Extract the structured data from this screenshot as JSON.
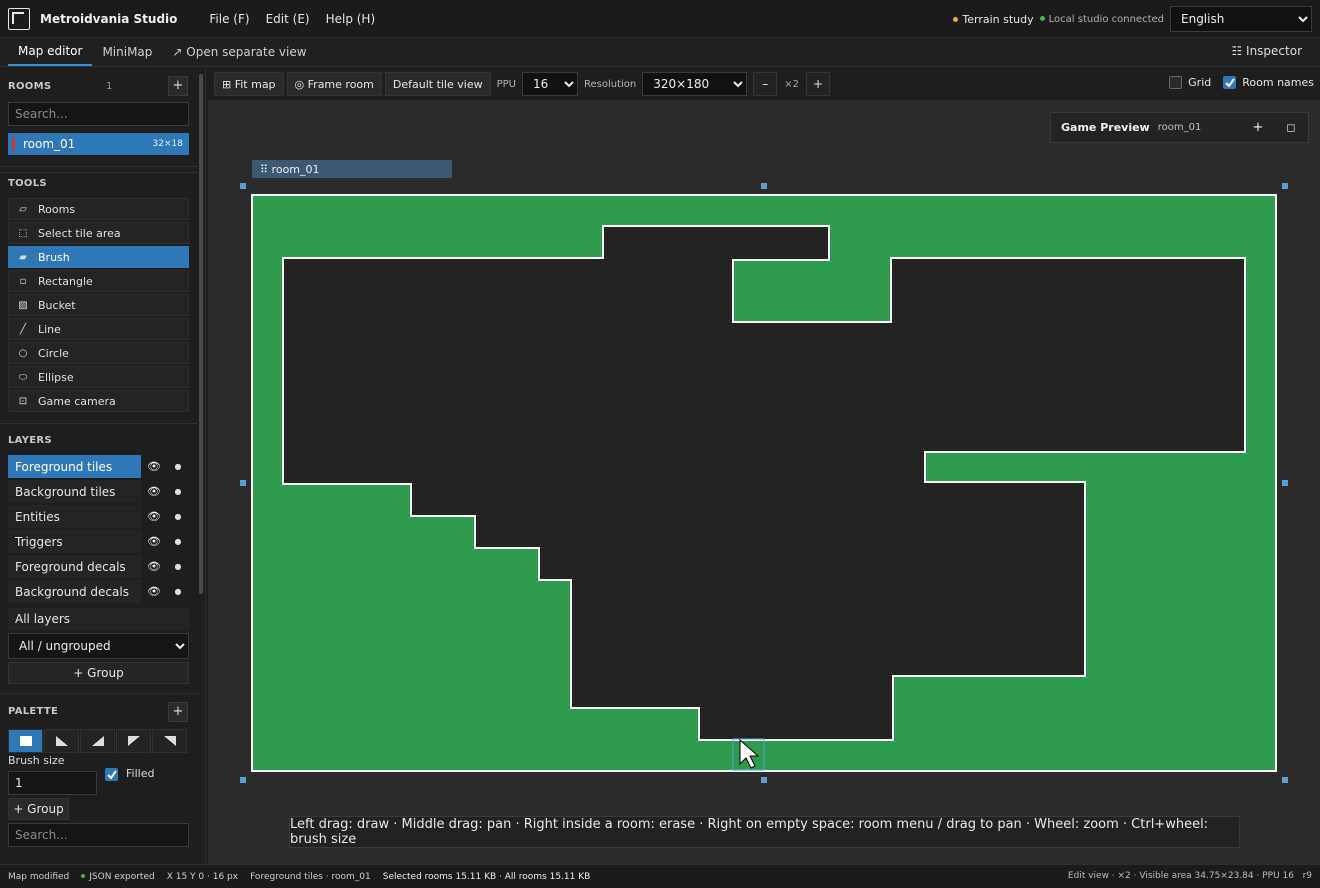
{
  "app": {
    "title": "Metroidvania Studio",
    "menu": [
      "File (F)",
      "Edit (E)",
      "Help (H)"
    ],
    "project_name": "Terrain study",
    "connection_status": "Local studio connected",
    "language": "English",
    "colors": {
      "accent": "#2f78b8",
      "terrain": "#2e9b4e",
      "empty": "#232323"
    }
  },
  "tabs": {
    "map_editor": "Map editor",
    "minimap": "MiniMap",
    "separate_view": "↗ Open separate view",
    "inspector": "☷ Inspector"
  },
  "sidebar": {
    "rooms": {
      "heading": "ROOMS",
      "count": "1",
      "add": "+",
      "search_placeholder": "Search...",
      "items": [
        {
          "name": "room_01",
          "size": "32×18"
        }
      ]
    },
    "tools": {
      "heading": "TOOLS",
      "items": [
        {
          "label": "Rooms",
          "icon": "▱"
        },
        {
          "label": "Select tile area",
          "icon": "⬚"
        },
        {
          "label": "Brush",
          "icon": "▰"
        },
        {
          "label": "Rectangle",
          "icon": "▫"
        },
        {
          "label": "Bucket",
          "icon": "▨"
        },
        {
          "label": "Line",
          "icon": "╱"
        },
        {
          "label": "Circle",
          "icon": "○"
        },
        {
          "label": "Ellipse",
          "icon": "⬭"
        },
        {
          "label": "Game camera",
          "icon": "⊡"
        }
      ],
      "active": "Brush"
    },
    "layers": {
      "heading": "LAYERS",
      "items": [
        "Foreground tiles",
        "Background tiles",
        "Entities",
        "Triggers",
        "Foreground decals",
        "Background decals"
      ],
      "active": "Foreground tiles",
      "all_layers": "All layers",
      "group_filter": "All / ungrouped",
      "add_group": "+ Group"
    },
    "palette": {
      "heading": "PALETTE",
      "add": "+",
      "brush_size_label": "Brush size",
      "brush_size": "1",
      "filled_label": "Filled",
      "filled": true,
      "add_group": "+ Group",
      "search_placeholder": "Search..."
    }
  },
  "toolbar": {
    "fit_map": "⊞ Fit map",
    "frame_room": "◎ Frame room",
    "default_tile_view": "Default tile view",
    "ppu_label": "PPU",
    "ppu": "16",
    "resolution_label": "Resolution",
    "resolution": "320×180",
    "zoom_out": "–",
    "zoom_level": "×2",
    "zoom_in": "+",
    "grid_label": "Grid",
    "grid": false,
    "room_names_label": "Room names",
    "room_names": true
  },
  "preview": {
    "title": "Game Preview",
    "room": "room_01",
    "add": "+",
    "maximize": "◻"
  },
  "canvas": {
    "room_label": "⠿ room_01",
    "hint": "Left drag: draw · Middle drag: pan · Right inside a room: erase · Right on empty space: room menu / drag to pan · Wheel: zoom · Ctrl+wheel: brush size"
  },
  "status": {
    "modified": "Map modified",
    "exported": "JSON exported",
    "cursor": "X 15 Y 0 · 16 px",
    "layer": "Foreground tiles · room_01",
    "sizes": "Selected rooms 15.11 KB · All rooms 15.11 KB",
    "view_info": "Edit view · ×2 · Visible area 34.75×23.84 · PPU 16",
    "revision": "r9"
  }
}
